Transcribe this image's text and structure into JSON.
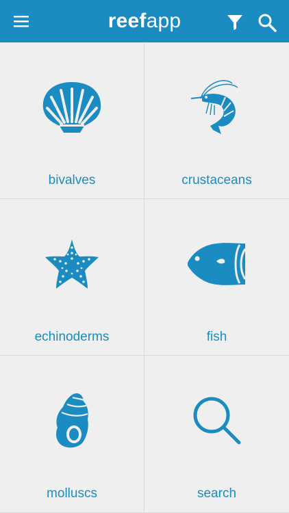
{
  "header": {
    "title_bold": "reef",
    "title_light": "app",
    "menu_icon": "hamburger-menu-icon",
    "filter_icon": "filter-icon",
    "search_icon": "search-icon",
    "background_color": "#1a8cc1"
  },
  "categories": [
    {
      "label": "bivalves",
      "icon": "shell-icon"
    },
    {
      "label": "crustaceans",
      "icon": "shrimp-icon"
    },
    {
      "label": "echinoderms",
      "icon": "starfish-icon"
    },
    {
      "label": "fish",
      "icon": "fish-icon"
    },
    {
      "label": "molluscs",
      "icon": "snail-shell-icon"
    },
    {
      "label": "search",
      "icon": "magnifier-icon"
    }
  ],
  "accent_color": "#1a8cc1"
}
